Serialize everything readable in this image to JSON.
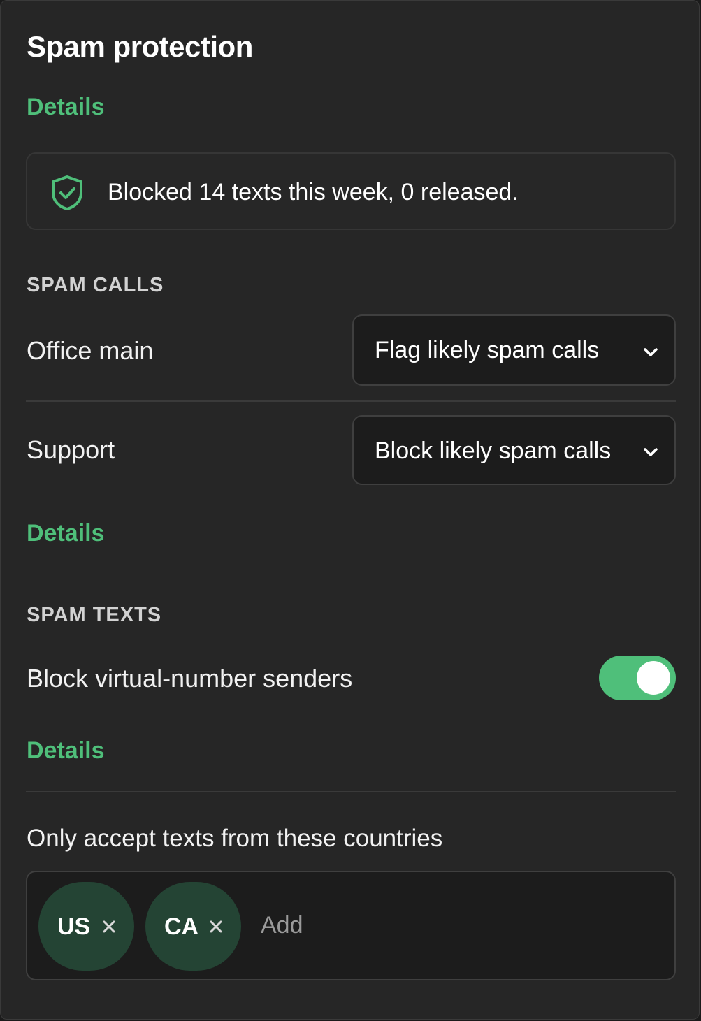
{
  "panel": {
    "title": "Spam protection",
    "details_link": "Details"
  },
  "summary": {
    "icon": "shield-check-icon",
    "text": "Blocked 14 texts this week, 0 released."
  },
  "spam_calls": {
    "section_label": "SPAM CALLS",
    "rows": [
      {
        "label": "Office main",
        "selected": "Flag likely spam calls"
      },
      {
        "label": "Support",
        "selected": "Block likely spam calls"
      }
    ],
    "details_link": "Details"
  },
  "spam_texts": {
    "section_label": "SPAM TEXTS",
    "toggle": {
      "label": "Block virtual-number senders",
      "on": true
    },
    "details_link": "Details",
    "countries": {
      "label": "Only accept texts from these countries",
      "chips": [
        "US",
        "CA"
      ],
      "add_placeholder": "Add"
    }
  },
  "colors": {
    "accent": "#4fbf7a",
    "chip_bg": "#244434",
    "panel_bg": "#262626"
  }
}
